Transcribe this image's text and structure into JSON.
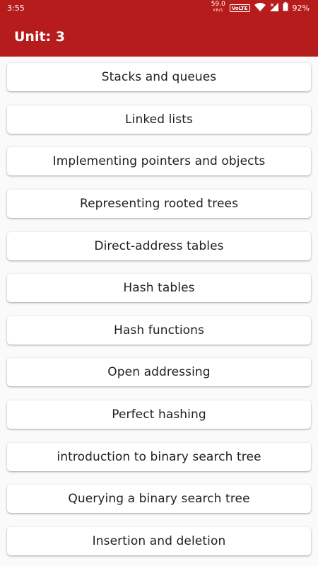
{
  "status_bar": {
    "time": "3:55",
    "net_speed_value": "59.0",
    "net_speed_unit": "KB/S",
    "volte_label": "VoLTE",
    "battery_percent": "92%",
    "icons": [
      "wifi-icon",
      "signal-icon",
      "battery-icon"
    ]
  },
  "header": {
    "title": "Unit: 3",
    "color": "#b71c1c"
  },
  "topics": [
    "Stacks and queues",
    "Linked lists",
    "Implementing pointers and objects",
    "Representing rooted trees",
    "Direct-address tables",
    "Hash tables",
    "Hash functions",
    "Open addressing",
    "Perfect hashing",
    "introduction to binary search tree",
    "Querying a binary search tree",
    "Insertion and deletion"
  ]
}
